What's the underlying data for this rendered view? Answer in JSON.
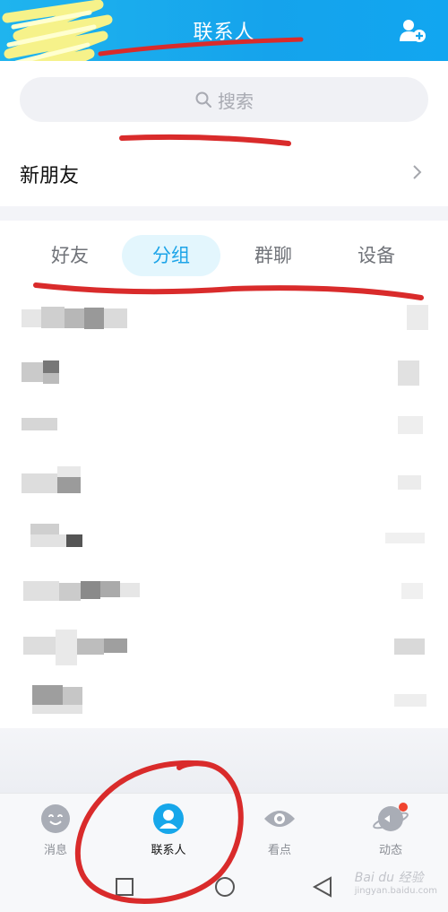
{
  "header": {
    "title": "联系人",
    "add_icon": "add-friend-icon"
  },
  "search": {
    "label": "搜索",
    "icon": "search-icon"
  },
  "new_friends": {
    "label": "新朋友",
    "icon": "chevron-right-icon"
  },
  "tabs": [
    {
      "label": "好友",
      "active": false
    },
    {
      "label": "分组",
      "active": true
    },
    {
      "label": "群聊",
      "active": false
    },
    {
      "label": "设备",
      "active": false
    }
  ],
  "bottom_nav": [
    {
      "label": "消息",
      "icon": "message-icon",
      "active": false
    },
    {
      "label": "联系人",
      "icon": "contacts-icon",
      "active": true
    },
    {
      "label": "看点",
      "icon": "eye-icon",
      "active": false
    },
    {
      "label": "动态",
      "icon": "planet-icon",
      "active": false,
      "badge": true
    }
  ],
  "system_nav": {
    "icons": [
      "square-icon",
      "circle-icon",
      "back-triangle-icon"
    ]
  },
  "watermark": {
    "brand": "Bai du 经验",
    "url": "jingyan.baidu.com"
  },
  "colors": {
    "header": "#15a3ec",
    "accent": "#1ca4e8",
    "tab_active_bg": "#e3f6fd",
    "annotation": "#d92b2b",
    "badge": "#f0442f"
  }
}
